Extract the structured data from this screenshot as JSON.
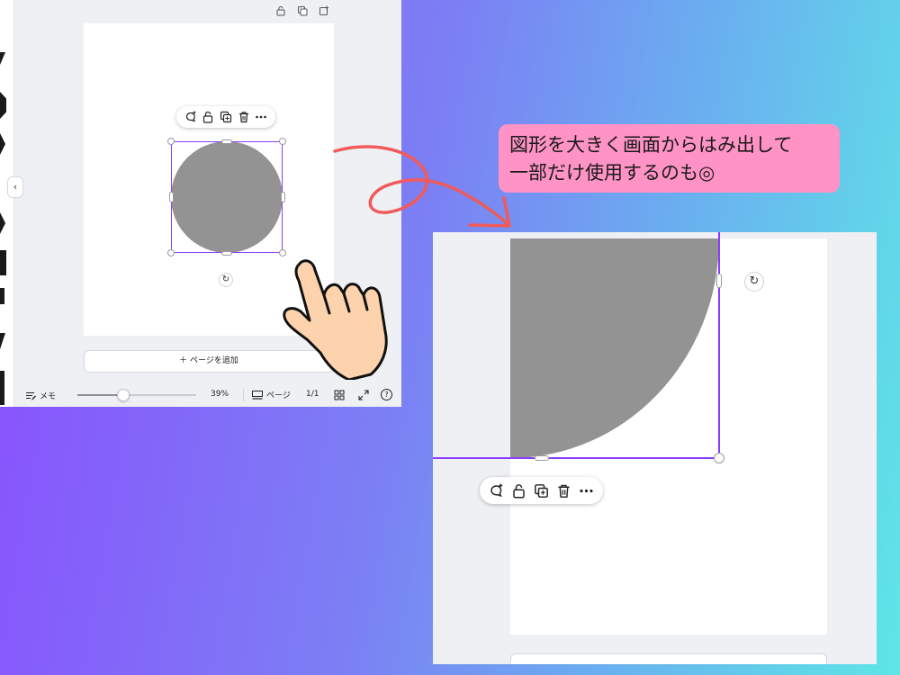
{
  "callout": {
    "line1": "図形を大きく画面からはみ出して",
    "line2": "一部だけ使用するのも◎"
  },
  "left_editor": {
    "add_page_label": "＋ ページを追加",
    "statusbar": {
      "memo_label": "メモ",
      "zoom_percent": 39,
      "zoom_text": "39%",
      "page_label": "ページ",
      "page_count": "1/1",
      "help_label": "?"
    },
    "toolbar_icons": [
      "comment-add-icon",
      "lock-icon",
      "duplicate-icon",
      "trash-icon",
      "more-icon"
    ],
    "shape_color": "#939393",
    "selection_color": "#8b3dff"
  },
  "right_editor": {
    "toolbar_icons": [
      "comment-add-icon",
      "lock-icon",
      "duplicate-icon",
      "trash-icon",
      "more-icon"
    ],
    "shape_color": "#939393"
  },
  "colors": {
    "callout_bg": "#ff93c5",
    "arrow": "#f05a5a",
    "gradient_start": "#8a4dfe",
    "gradient_end": "#5ee6e6"
  }
}
